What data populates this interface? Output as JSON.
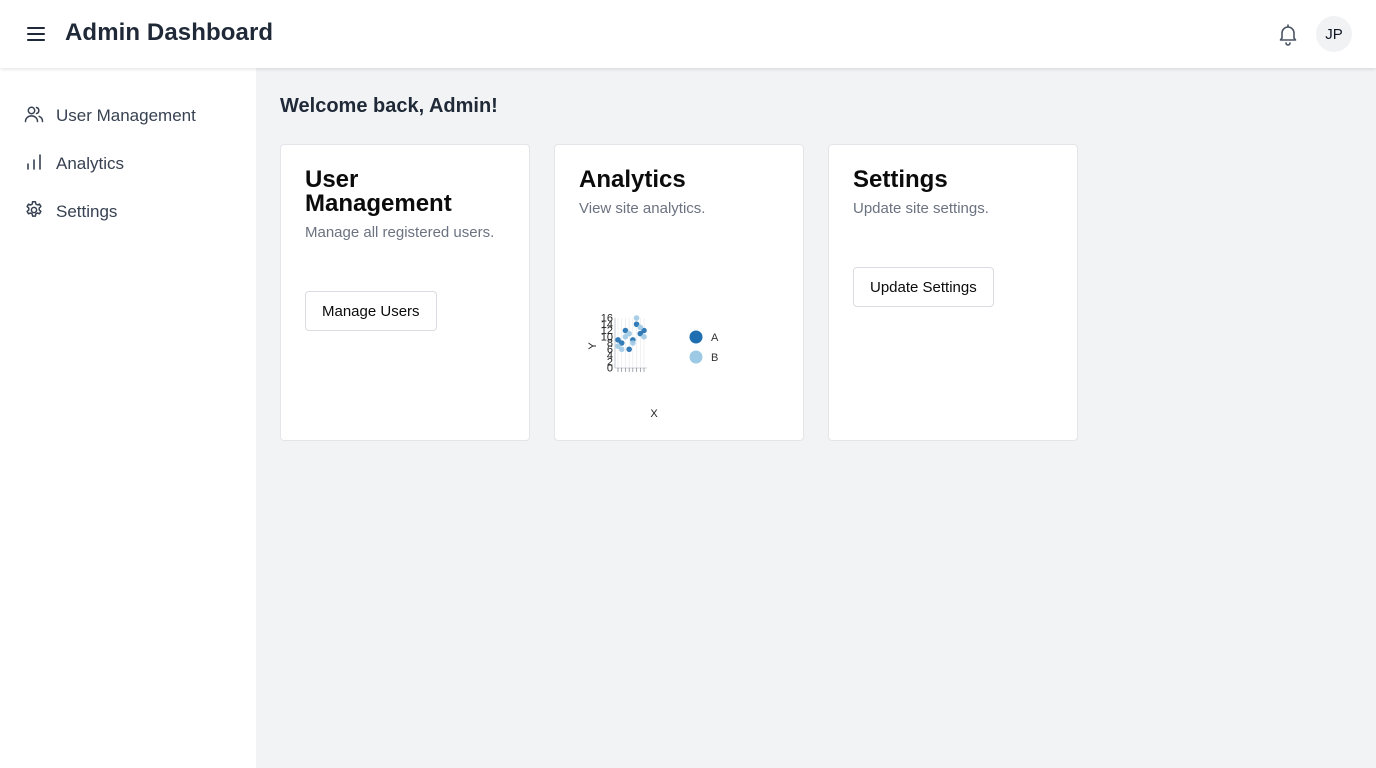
{
  "header": {
    "title": "Admin Dashboard",
    "avatar_initials": "JP"
  },
  "sidebar": {
    "items": [
      {
        "label": "User Management",
        "icon": "users-icon"
      },
      {
        "label": "Analytics",
        "icon": "bar-chart-icon"
      },
      {
        "label": "Settings",
        "icon": "gear-icon"
      }
    ]
  },
  "main": {
    "welcome": "Welcome back, Admin!",
    "cards": [
      {
        "title": "User Management",
        "description": "Manage all registered users.",
        "button": "Manage Users"
      },
      {
        "title": "Analytics",
        "description": "View site analytics."
      },
      {
        "title": "Settings",
        "description": "Update site settings.",
        "button": "Update Settings"
      }
    ]
  },
  "colors": {
    "series_a": "#1f6fb0",
    "series_b": "#9ec9e4",
    "background": "#f2f3f5"
  },
  "chart_data": {
    "type": "scatter",
    "xlabel": "X",
    "ylabel": "Y",
    "y_ticks": [
      "0",
      "2",
      "4",
      "6",
      "8",
      "10",
      "12",
      "14",
      "16"
    ],
    "ylim": [
      0,
      16
    ],
    "grid": true,
    "legend_position": "right",
    "series": [
      {
        "name": "A",
        "values": [
          9,
          8,
          12,
          6,
          9,
          14,
          11,
          12
        ]
      },
      {
        "name": "B",
        "values": [
          7,
          6,
          10,
          11,
          8,
          16,
          13,
          10
        ]
      }
    ]
  }
}
